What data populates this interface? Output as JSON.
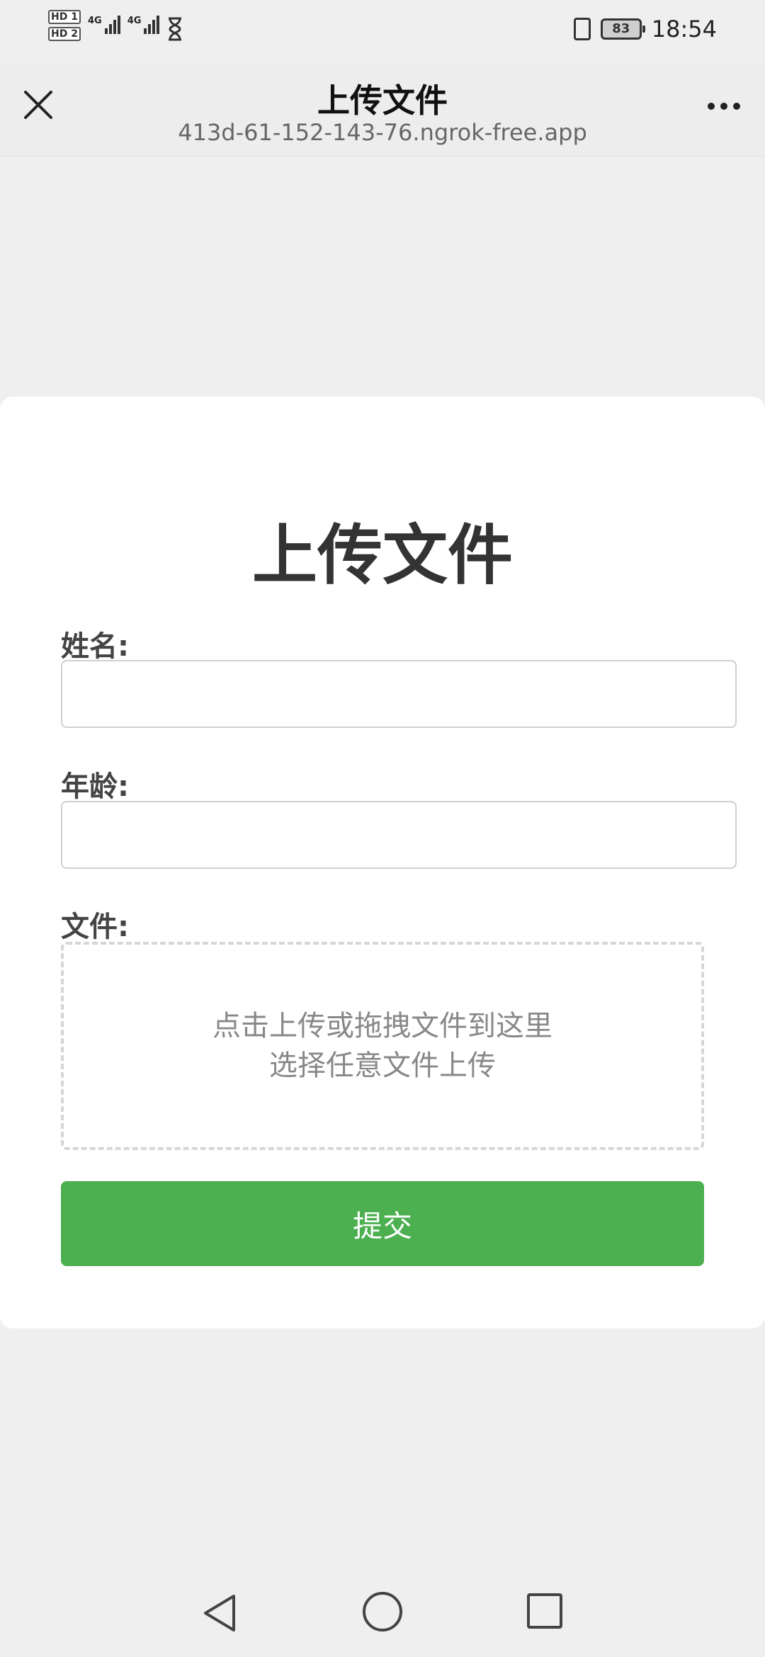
{
  "status_bar": {
    "sim1_badge": "HD",
    "sim1_index": "1",
    "sim2_badge": "HD",
    "sim2_index": "2",
    "network1": "4G",
    "network2": "4G",
    "battery": "83",
    "time": "18:54"
  },
  "title_bar": {
    "title": "上传文件",
    "url": "413d-61-152-143-76.ngrok-free.app"
  },
  "form": {
    "heading": "上传文件",
    "name_label": "姓名:",
    "name_value": "",
    "age_label": "年龄:",
    "age_value": "",
    "file_label": "文件:",
    "dropzone_line1": "点击上传或拖拽文件到这里",
    "dropzone_line2": "选择任意文件上传",
    "submit_label": "提交"
  },
  "colors": {
    "accent": "#4caf50",
    "background": "#efefef"
  }
}
